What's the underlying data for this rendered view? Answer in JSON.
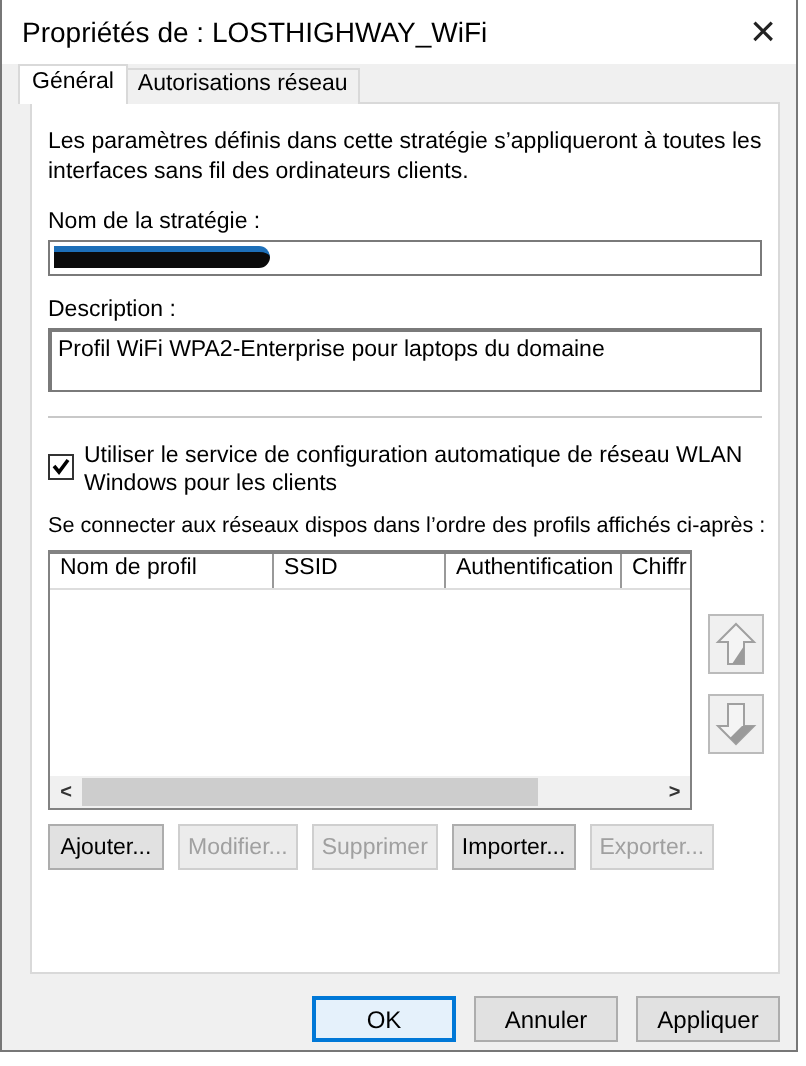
{
  "window": {
    "title": "Propriétés de : LOSTHIGHWAY_WiFi",
    "close": "×"
  },
  "tabs": [
    {
      "label": "Général",
      "selected": true
    },
    {
      "label": "Autorisations réseau",
      "selected": false
    }
  ],
  "intro": "Les paramètres définis dans cette stratégie s’appliqueront à toutes les interfaces sans fil des ordinateurs clients.",
  "policy_name": {
    "label": "Nom de la stratégie :",
    "redacted": true
  },
  "description": {
    "label": "Description :",
    "value": "Profil WiFi WPA2-Enterprise pour laptops du domaine"
  },
  "wlan_service": {
    "label": "Utiliser le service de configuration automatique de réseau WLAN Windows pour les clients",
    "checked": true
  },
  "profiles": {
    "label": "Se connecter aux réseaux dispos dans l’ordre des profils affichés ci-après :",
    "columns": [
      "Nom de profil",
      "SSID",
      "Authentification",
      "Chiffr"
    ],
    "scroll_left": "<",
    "scroll_right": ">"
  },
  "profile_buttons": [
    {
      "label": "Ajouter...",
      "disabled": false
    },
    {
      "label": "Modifier...",
      "disabled": true
    },
    {
      "label": "Supprimer",
      "disabled": true
    },
    {
      "label": "Importer...",
      "disabled": false
    },
    {
      "label": "Exporter...",
      "disabled": true
    }
  ],
  "dialog_buttons": [
    {
      "label": "OK",
      "default": true
    },
    {
      "label": "Annuler",
      "default": false
    },
    {
      "label": "Appliquer",
      "default": false
    }
  ]
}
